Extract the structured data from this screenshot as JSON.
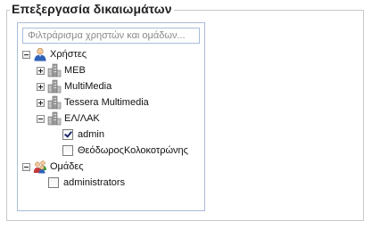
{
  "fieldset": {
    "legend": "Επεξεργασία δικαιωμάτων"
  },
  "filter": {
    "placeholder": "Φιλτράρισμα χρηστών και ομάδων...",
    "value": ""
  },
  "tree": {
    "users": {
      "label": "Χρήστες",
      "groups": [
        {
          "label": "ΜΕΒ",
          "expanded": false
        },
        {
          "label": "MultiMedia",
          "expanded": false
        },
        {
          "label": "Tessera Multimedia",
          "expanded": false
        },
        {
          "label": "ΕΛ/ΛΑΚ",
          "expanded": true,
          "members": [
            {
              "label": "admin",
              "checked": true
            },
            {
              "label": "ΘεόδωροςΚολοκοτρώνης",
              "checked": false
            }
          ]
        }
      ]
    },
    "teams": {
      "label": "Ομάδες",
      "members": [
        {
          "label": "administrators",
          "checked": false
        }
      ]
    }
  },
  "colors": {
    "border": "#c9c9c9",
    "panel_border": "#a9bcd9",
    "user_icon": "#2f62b8",
    "group_icon": "#9a9a9a"
  }
}
